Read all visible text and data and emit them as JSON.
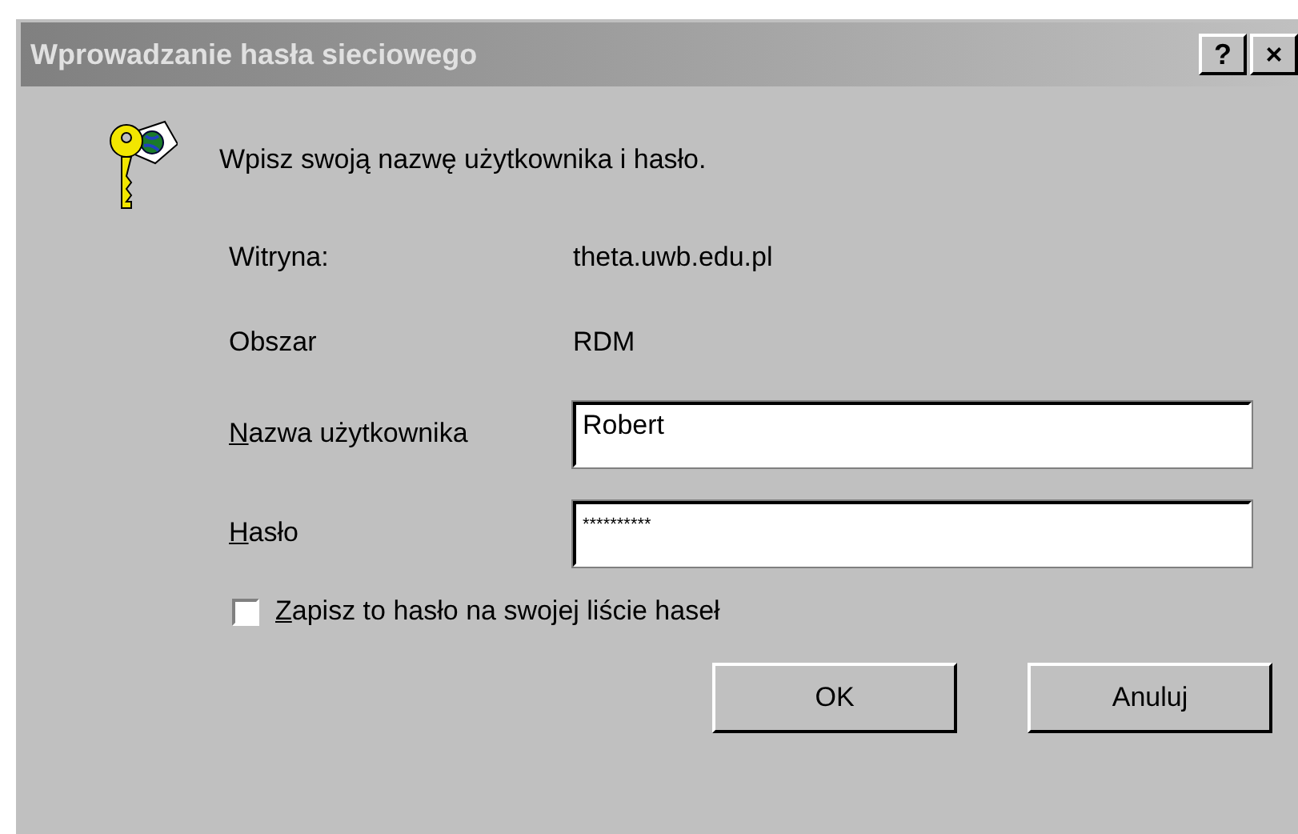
{
  "window": {
    "title": "Wprowadzanie hasła sieciowego",
    "title_buttons": [
      "?",
      "×"
    ]
  },
  "message": "Wpisz swoją nazwę użytkownika i hasło.",
  "info": [
    {
      "label": "Witryna:",
      "value": "theta.uwb.edu.pl"
    },
    {
      "label": "Obszar",
      "value": "RDM"
    }
  ],
  "fields": [
    {
      "key": "N",
      "rest": "azwa użytkownika",
      "value": "Robert"
    },
    {
      "key": "H",
      "rest": "asło",
      "value": "**********"
    }
  ],
  "save_password": {
    "key": "Z",
    "rest": "apisz to hasło na swojej liście haseł",
    "checked": false
  },
  "buttons": [
    "OK",
    "Anuluj"
  ]
}
